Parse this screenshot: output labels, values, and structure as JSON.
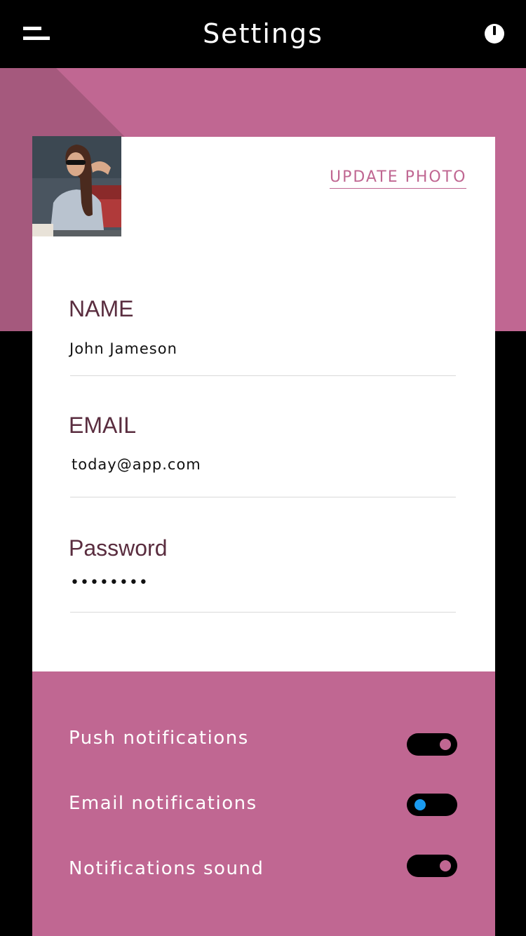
{
  "app": {
    "title": "Settings"
  },
  "colors": {
    "accent": "#c06792",
    "label": "#5a2d3f",
    "toggle_off_knob": "#1a9bf0"
  },
  "icons": {
    "menu": "menu-icon",
    "power": "power-icon"
  },
  "profile": {
    "update_photo_label": "UPDATE PHOTO",
    "name_label": "NAME",
    "name_value": "John Jameson",
    "email_label": "EMAIL",
    "email_value": "today@app.com",
    "password_label": "Password",
    "password_value": "••••••••"
  },
  "notifications": [
    {
      "label": "Push notifications",
      "enabled": true
    },
    {
      "label": "Email notifications",
      "enabled": false
    },
    {
      "label": "Notifications sound",
      "enabled": true
    }
  ]
}
